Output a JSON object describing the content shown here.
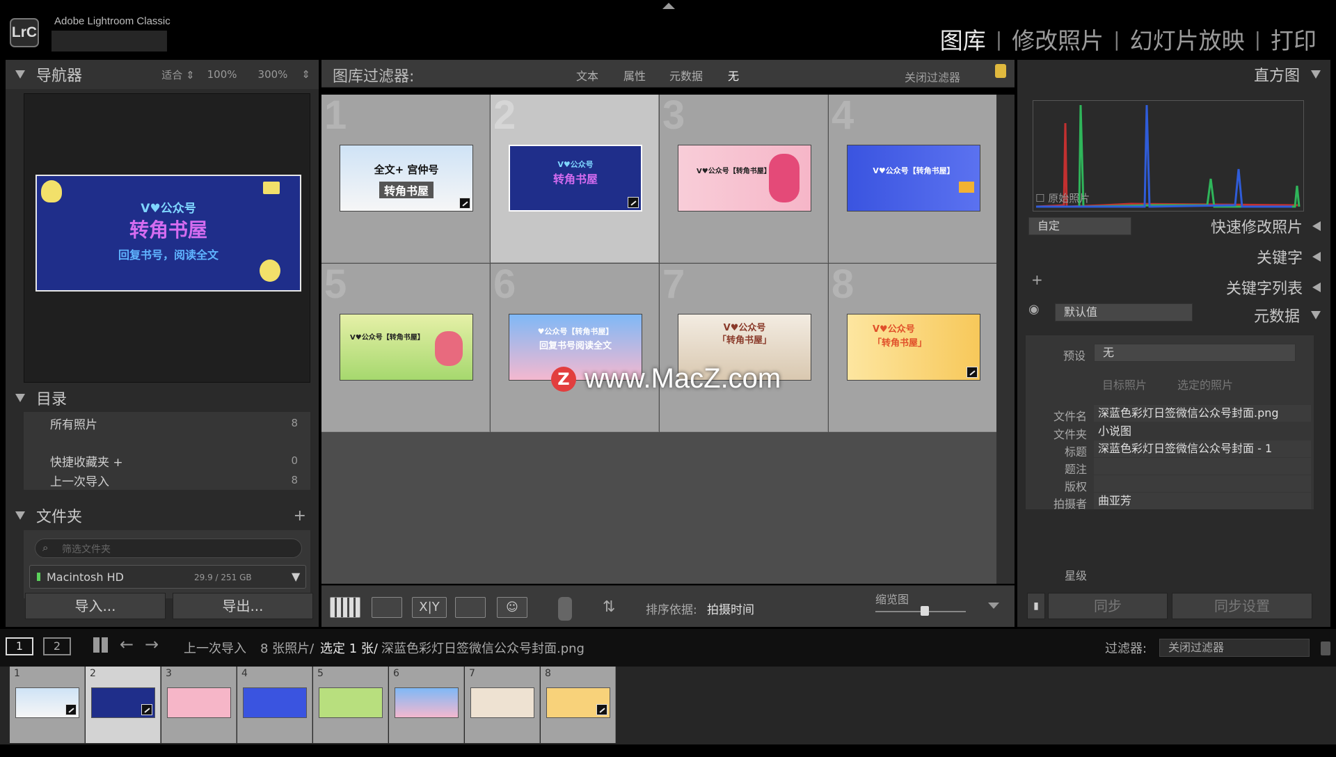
{
  "app": {
    "name": "Adobe Lightroom Classic",
    "logo": "LrC"
  },
  "modules": [
    {
      "label": "图库",
      "active": true
    },
    {
      "label": "修改照片",
      "active": false
    },
    {
      "label": "幻灯片放映",
      "active": false
    },
    {
      "label": "打印",
      "active": false
    }
  ],
  "navigator": {
    "title": "导航器",
    "fit": "适合",
    "z100": "100%",
    "z300": "300%"
  },
  "catalog": {
    "title": "目录",
    "items": [
      {
        "label": "所有照片",
        "count": "8"
      },
      {
        "label": "快捷收藏夹 +",
        "count": "0"
      },
      {
        "label": "上一次导入",
        "count": "8"
      }
    ]
  },
  "folders": {
    "title": "文件夹",
    "add": "+",
    "search_placeholder": "筛选文件夹",
    "drive": "Macintosh HD",
    "drive_size": "29.9 / 251 GB"
  },
  "buttons": {
    "import": "导入...",
    "export": "导出..."
  },
  "filterbar": {
    "title": "图库过滤器:",
    "tabs": [
      "文本",
      "属性",
      "元数据",
      "无"
    ],
    "close": "关闭过滤器"
  },
  "grid": {
    "cells": [
      {
        "num": "1",
        "line1": "全文+ 宫仲号",
        "line2": "转角书屋"
      },
      {
        "num": "2",
        "line1": "V♥公众号",
        "line2": "转角书屋"
      },
      {
        "num": "3",
        "line1": "V♥公众号【转角书屋】",
        "line2": ""
      },
      {
        "num": "4",
        "line1": "V♥公众号【转角书屋】",
        "line2": ""
      },
      {
        "num": "5",
        "line1": "V♥公众号【转角书屋】",
        "line2": ""
      },
      {
        "num": "6",
        "line1": "♥公众号【转角书屋】",
        "line2": "回复书号阅读全文"
      },
      {
        "num": "7",
        "line1": "V♥公众号",
        "line2": "「转角书屋」"
      },
      {
        "num": "8",
        "line1": "V♥公众号",
        "line2": "「转角书屋」"
      }
    ],
    "selected_index": 2
  },
  "navigator_preview": {
    "line1": "V♥公众号",
    "line2": "转角书屋",
    "line3": "回复书号，阅读全文"
  },
  "watermark": {
    "logo": "Z",
    "text": "www.MacZ.com"
  },
  "toolbar": {
    "sort_label": "排序依据:",
    "sort_value": "拍摄时间",
    "thumb_label": "缩览图",
    "thumb_level": 0.55
  },
  "statusbar": {
    "view1": "1",
    "view2": "2",
    "source": "上一次导入",
    "count": "8 张照片/",
    "selected": "选定 1 张/",
    "filename": "深蓝色彩灯日签微信公众号封面.png",
    "filter_label": "过滤器:",
    "filter_value": "关闭过滤器"
  },
  "filmstrip": [
    "1",
    "2",
    "3",
    "4",
    "5",
    "6",
    "7",
    "8"
  ],
  "right": {
    "histogram": "直方图",
    "original": "原始照片",
    "quick_preset": "自定",
    "quick": "快速修改照片",
    "keywords": "关键字",
    "keyword_list": "关键字列表",
    "metadata_preset": "默认值",
    "metadata": "元数据",
    "preset_label": "预设",
    "preset_value": "无",
    "target_photo": "目标照片",
    "selected_photos": "选定的照片",
    "fields": [
      {
        "label": "文件名",
        "value": "深蓝色彩灯日签微信公众号封面.png"
      },
      {
        "label": "文件夹",
        "value": "小说图"
      },
      {
        "label": "标题",
        "value": "深蓝色彩灯日签微信公众号封面 - 1"
      },
      {
        "label": "题注",
        "value": ""
      },
      {
        "label": "版权",
        "value": ""
      },
      {
        "label": "拍摄者",
        "value": "曲亚芳"
      },
      {
        "label": "星级",
        "value": ""
      }
    ],
    "sync": "同步",
    "sync_settings": "同步设置"
  },
  "colors": {
    "accent_blue": "#1f2e8a",
    "bg_dark": "#000000",
    "panel": "#3a3a3a"
  }
}
